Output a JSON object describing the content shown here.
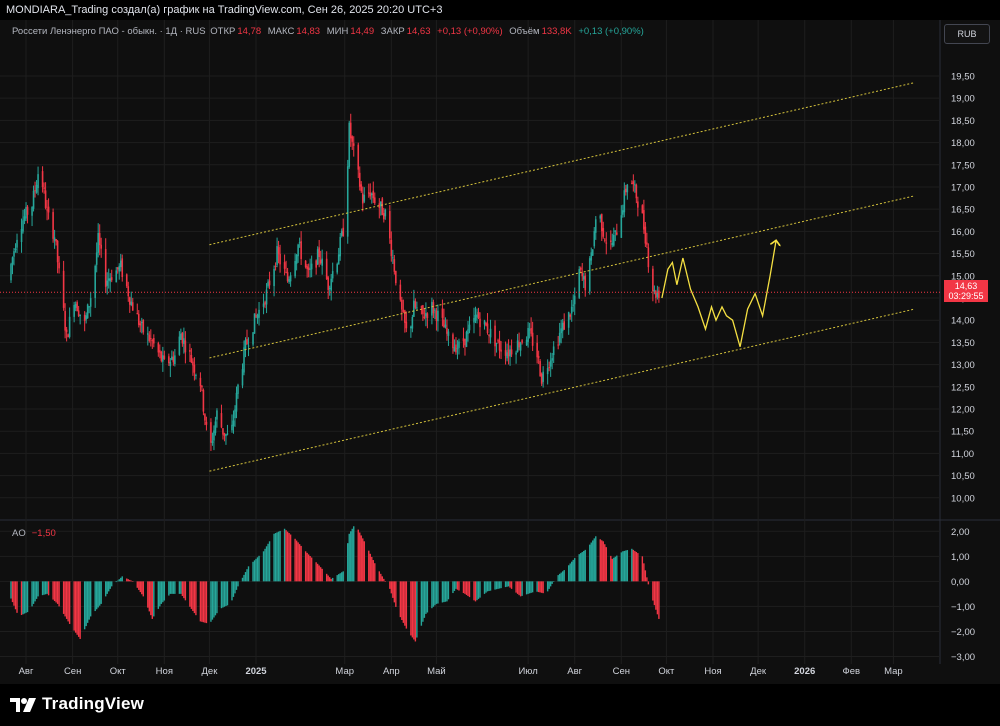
{
  "header": {
    "attribution": "MONDIARA_Trading создал(а) график на TradingView.com, Сен 26, 2025 20:20 UTC+3"
  },
  "legend": {
    "symbol": "Россети Ленэнерго ПАО - обыкн. · 1Д · RUS",
    "open_label": "ОТКР",
    "open": "14,78",
    "high_label": "МАКС",
    "high": "14,83",
    "low_label": "МИН",
    "low": "14,49",
    "close_label": "ЗАКР",
    "close": "14,63",
    "change": "+0,13 (+0,90%)",
    "volume_label": "Объём",
    "volume": "133,8K",
    "volume_change": "+0,13 (+0,90%)"
  },
  "currency": "RUB",
  "price_tag": {
    "price": "14,63",
    "countdown": "03:29:55"
  },
  "oscillator": {
    "name": "AO",
    "value": "−1,50"
  },
  "brand": {
    "name": "TradingView"
  },
  "colors": {
    "background": "#0f0f0f",
    "up": "#26a69a",
    "down": "#f23645",
    "channel": "#d4c23b",
    "forecast": "#f5e042",
    "grid": "#1e1e1e",
    "text": "#d1d4dc"
  },
  "chart_data": {
    "type": "candlestick",
    "price_axis": {
      "ticks": [
        "19,50",
        "19,00",
        "18,50",
        "18,00",
        "17,50",
        "17,00",
        "16,50",
        "16,00",
        "15,50",
        "15,00",
        "14,50",
        "14,00",
        "13,50",
        "13,00",
        "12,50",
        "12,00",
        "11,50",
        "11,00",
        "10,50",
        "10,00"
      ],
      "tick_values": [
        19.5,
        19.0,
        18.5,
        18.0,
        17.5,
        17.0,
        16.5,
        16.0,
        15.5,
        15.0,
        14.5,
        14.0,
        13.5,
        13.0,
        12.5,
        12.0,
        11.5,
        11.0,
        10.5,
        10.0
      ],
      "range": [
        9.5,
        19.95
      ]
    },
    "ao_axis": {
      "ticks": [
        "2,00",
        "1,00",
        "0,00",
        "−1,00",
        "−2,00",
        "−3,00"
      ],
      "tick_values": [
        2,
        1,
        0,
        -1,
        -2,
        -3
      ],
      "range": [
        -3.3,
        2.45
      ]
    },
    "time_axis": {
      "labels": [
        "Авг",
        "Сен",
        "Окт",
        "Ноя",
        "Дек",
        "2025",
        "Мар",
        "Апр",
        "Май",
        "Июл",
        "Авг",
        "Сен",
        "Окт",
        "Ноя",
        "Дек",
        "2026",
        "Фев",
        "Мар"
      ],
      "label_dates": [
        "2024-08-01",
        "2024-09-01",
        "2024-10-01",
        "2024-11-01",
        "2024-12-01",
        "2025-01-01",
        "2025-03-01",
        "2025-04-01",
        "2025-05-01",
        "2025-07-01",
        "2025-08-01",
        "2025-09-01",
        "2025-10-01",
        "2025-11-01",
        "2025-12-01",
        "2026-01-01",
        "2026-02-01",
        "2026-03-01"
      ],
      "bold": [
        5,
        15
      ],
      "range": [
        "2024-07-20",
        "2026-04-01"
      ]
    },
    "current_price": 14.63,
    "price_path": [
      [
        "2024-07-20",
        14.9
      ],
      [
        "2024-07-27",
        16.1
      ],
      [
        "2024-08-05",
        16.6
      ],
      [
        "2024-08-10",
        17.5
      ],
      [
        "2024-08-15",
        16.4
      ],
      [
        "2024-08-20",
        15.9
      ],
      [
        "2024-08-28",
        13.6
      ],
      [
        "2024-09-02",
        14.5
      ],
      [
        "2024-09-09",
        13.9
      ],
      [
        "2024-09-14",
        14.7
      ],
      [
        "2024-09-18",
        15.8
      ],
      [
        "2024-09-23",
        14.9
      ],
      [
        "2024-10-03",
        15.2
      ],
      [
        "2024-10-10",
        14.4
      ],
      [
        "2024-10-17",
        13.8
      ],
      [
        "2024-10-24",
        13.5
      ],
      [
        "2024-11-01",
        13.0
      ],
      [
        "2024-11-08",
        13.2
      ],
      [
        "2024-11-12",
        13.7
      ],
      [
        "2024-11-18",
        13.2
      ],
      [
        "2024-11-25",
        12.6
      ],
      [
        "2024-12-01",
        11.0
      ],
      [
        "2024-12-06",
        11.9
      ],
      [
        "2024-12-10",
        11.5
      ],
      [
        "2024-12-15",
        11.3
      ],
      [
        "2024-12-20",
        12.5
      ],
      [
        "2024-12-25",
        13.4
      ],
      [
        "2024-12-30",
        13.9
      ],
      [
        "2025-01-08",
        14.6
      ],
      [
        "2025-01-15",
        15.5
      ],
      [
        "2025-01-22",
        14.9
      ],
      [
        "2025-01-29",
        15.7
      ],
      [
        "2025-02-05",
        15.0
      ],
      [
        "2025-02-12",
        15.5
      ],
      [
        "2025-02-18",
        14.8
      ],
      [
        "2025-02-24",
        15.4
      ],
      [
        "2025-03-01",
        16.2
      ],
      [
        "2025-03-04",
        18.3
      ],
      [
        "2025-03-08",
        17.6
      ],
      [
        "2025-03-13",
        16.7
      ],
      [
        "2025-03-18",
        16.9
      ],
      [
        "2025-03-23",
        16.6
      ],
      [
        "2025-03-28",
        16.4
      ],
      [
        "2025-04-02",
        15.4
      ],
      [
        "2025-04-07",
        14.3
      ],
      [
        "2025-04-12",
        13.6
      ],
      [
        "2025-04-16",
        14.3
      ],
      [
        "2025-04-22",
        14.1
      ],
      [
        "2025-04-28",
        14.3
      ],
      [
        "2025-05-04",
        14.0
      ],
      [
        "2025-05-10",
        13.5
      ],
      [
        "2025-05-16",
        13.4
      ],
      [
        "2025-05-22",
        13.7
      ],
      [
        "2025-05-28",
        14.1
      ],
      [
        "2025-06-04",
        13.8
      ],
      [
        "2025-06-12",
        13.4
      ],
      [
        "2025-06-18",
        13.3
      ],
      [
        "2025-06-25",
        13.5
      ],
      [
        "2025-07-01",
        13.7
      ],
      [
        "2025-07-06",
        13.4
      ],
      [
        "2025-07-10",
        12.7
      ],
      [
        "2025-07-16",
        13.2
      ],
      [
        "2025-07-22",
        13.7
      ],
      [
        "2025-07-28",
        14.1
      ],
      [
        "2025-08-01",
        14.4
      ],
      [
        "2025-08-04",
        15.1
      ],
      [
        "2025-08-08",
        14.8
      ],
      [
        "2025-08-12",
        15.4
      ],
      [
        "2025-08-16",
        16.6
      ],
      [
        "2025-08-20",
        16.0
      ],
      [
        "2025-08-24",
        15.6
      ],
      [
        "2025-08-28",
        15.9
      ],
      [
        "2025-09-02",
        16.6
      ],
      [
        "2025-09-06",
        17.3
      ],
      [
        "2025-09-10",
        16.9
      ],
      [
        "2025-09-14",
        16.5
      ],
      [
        "2025-09-18",
        15.7
      ],
      [
        "2025-09-20",
        15.0
      ],
      [
        "2025-09-23",
        14.6
      ],
      [
        "2025-09-26",
        14.63
      ]
    ],
    "ao_path": [
      [
        "2024-07-20",
        -0.4
      ],
      [
        "2024-07-27",
        -1.4
      ],
      [
        "2024-08-03",
        -1.2
      ],
      [
        "2024-08-09",
        -0.6
      ],
      [
        "2024-08-15",
        -0.5
      ],
      [
        "2024-08-22",
        -0.9
      ],
      [
        "2024-08-31",
        -1.8
      ],
      [
        "2024-09-06",
        -2.3
      ],
      [
        "2024-09-13",
        -1.4
      ],
      [
        "2024-09-20",
        -0.9
      ],
      [
        "2024-09-27",
        -0.2
      ],
      [
        "2024-10-04",
        0.2
      ],
      [
        "2024-10-11",
        0.0
      ],
      [
        "2024-10-18",
        -0.6
      ],
      [
        "2024-10-24",
        -1.5
      ],
      [
        "2024-10-30",
        -0.9
      ],
      [
        "2024-11-05",
        -0.5
      ],
      [
        "2024-11-12",
        -0.5
      ],
      [
        "2024-11-19",
        -1.1
      ],
      [
        "2024-11-25",
        -1.6
      ],
      [
        "2024-12-01",
        -1.7
      ],
      [
        "2024-12-08",
        -1.1
      ],
      [
        "2024-12-15",
        -0.9
      ],
      [
        "2024-12-20",
        -0.2
      ],
      [
        "2024-12-27",
        0.6
      ],
      [
        "2025-01-06",
        1.2
      ],
      [
        "2025-01-13",
        1.9
      ],
      [
        "2025-01-20",
        2.1
      ],
      [
        "2025-01-27",
        1.7
      ],
      [
        "2025-02-03",
        1.2
      ],
      [
        "2025-02-11",
        0.7
      ],
      [
        "2025-02-20",
        0.1
      ],
      [
        "2025-02-28",
        0.4
      ],
      [
        "2025-03-04",
        1.9
      ],
      [
        "2025-03-08",
        2.3
      ],
      [
        "2025-03-14",
        1.6
      ],
      [
        "2025-03-22",
        0.6
      ],
      [
        "2025-03-31",
        -0.3
      ],
      [
        "2025-04-05",
        -1.2
      ],
      [
        "2025-04-12",
        -2.0
      ],
      [
        "2025-04-17",
        -2.4
      ],
      [
        "2025-04-24",
        -1.3
      ],
      [
        "2025-05-01",
        -0.9
      ],
      [
        "2025-05-08",
        -0.8
      ],
      [
        "2025-05-14",
        -0.3
      ],
      [
        "2025-05-20",
        -0.5
      ],
      [
        "2025-05-27",
        -0.8
      ],
      [
        "2025-06-04",
        -0.4
      ],
      [
        "2025-06-11",
        -0.3
      ],
      [
        "2025-06-18",
        -0.2
      ],
      [
        "2025-06-26",
        -0.6
      ],
      [
        "2025-07-06",
        -0.4
      ],
      [
        "2025-07-13",
        -0.5
      ],
      [
        "2025-07-20",
        0.2
      ],
      [
        "2025-07-26",
        0.5
      ],
      [
        "2025-08-02",
        1.0
      ],
      [
        "2025-08-09",
        1.3
      ],
      [
        "2025-08-15",
        1.8
      ],
      [
        "2025-08-20",
        1.6
      ],
      [
        "2025-08-26",
        0.9
      ],
      [
        "2025-09-02",
        1.2
      ],
      [
        "2025-09-08",
        1.3
      ],
      [
        "2025-09-15",
        1.0
      ],
      [
        "2025-09-20",
        -0.4
      ],
      [
        "2025-09-26",
        -1.5
      ]
    ],
    "channel_lines": [
      {
        "from": [
          "2024-12-01",
          10.6
        ],
        "to": [
          "2026-03-15",
          14.25
        ]
      },
      {
        "from": [
          "2024-12-01",
          13.15
        ],
        "to": [
          "2026-03-15",
          16.8
        ]
      },
      {
        "from": [
          "2024-12-01",
          15.7
        ],
        "to": [
          "2026-03-15",
          19.35
        ]
      }
    ],
    "forecast": [
      [
        "2025-09-28",
        14.5
      ],
      [
        "2025-10-02",
        15.15
      ],
      [
        "2025-10-05",
        15.3
      ],
      [
        "2025-10-08",
        14.8
      ],
      [
        "2025-10-12",
        15.4
      ],
      [
        "2025-10-17",
        14.7
      ],
      [
        "2025-10-22",
        14.3
      ],
      [
        "2025-10-27",
        13.8
      ],
      [
        "2025-10-31",
        14.3
      ],
      [
        "2025-11-03",
        14.0
      ],
      [
        "2025-11-07",
        14.3
      ],
      [
        "2025-11-10",
        14.1
      ],
      [
        "2025-11-14",
        14.0
      ],
      [
        "2025-11-19",
        13.4
      ],
      [
        "2025-11-24",
        14.25
      ],
      [
        "2025-11-29",
        14.6
      ],
      [
        "2025-12-04",
        14.1
      ],
      [
        "2025-12-09",
        15.0
      ],
      [
        "2025-12-13",
        15.8
      ]
    ]
  }
}
